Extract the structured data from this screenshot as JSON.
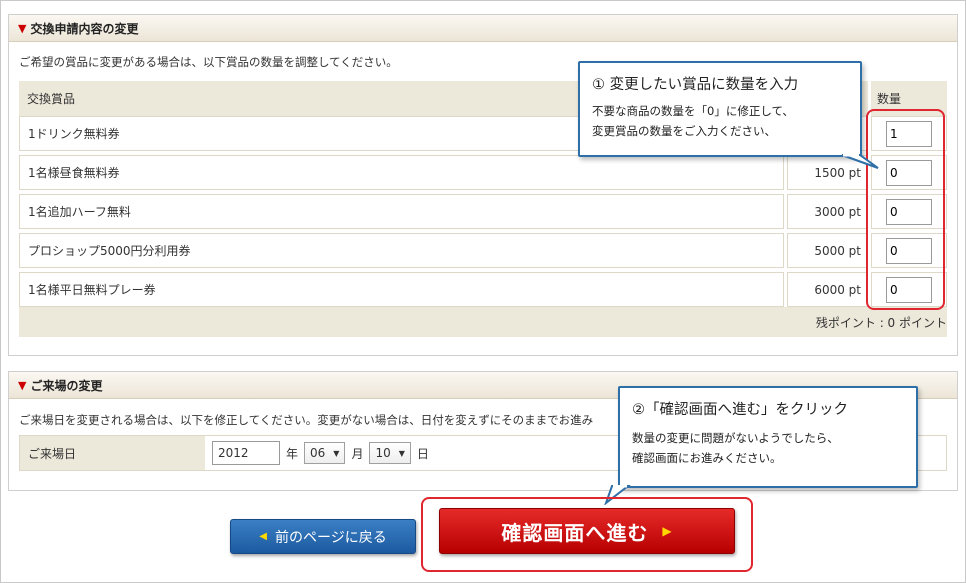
{
  "exchange_section": {
    "title": "交換申請内容の変更",
    "description": "ご希望の賞品に変更がある場合は、以下賞品の数量を調整してください。",
    "headers": {
      "item": "交換賞品",
      "qty": "数量"
    },
    "items": [
      {
        "name": "1ドリンク無料券",
        "points": "",
        "qty": "1"
      },
      {
        "name": "1名様昼食無料券",
        "points": "1500 pt",
        "qty": "0"
      },
      {
        "name": "1名追加ハーフ無料",
        "points": "3000 pt",
        "qty": "0"
      },
      {
        "name": "プロショップ5000円分利用券",
        "points": "5000 pt",
        "qty": "0"
      },
      {
        "name": "1名様平日無料プレー券",
        "points": "6000 pt",
        "qty": "0"
      }
    ],
    "remaining": "残ポイント : 0 ポイント"
  },
  "callout1": {
    "title": "① 変更したい賞品に数量を入力",
    "line1": "不要な商品の数量を「0」に修正して、",
    "line2": "変更賞品の数量をご入力ください、"
  },
  "visit_section": {
    "title": "ご来場の変更",
    "description": "ご来場日を変更される場合は、以下を修正してください。変更がない場合は、日付を変えずにそのままでお進み",
    "label": "ご来場日",
    "year": "2012",
    "year_unit": "年",
    "month": "06",
    "month_unit": "月",
    "day": "10",
    "day_unit": "日"
  },
  "callout2": {
    "title": "②「確認画面へ進む」をクリック",
    "line1": "数量の変更に問題がないようでしたら、",
    "line2": "確認画面にお進みください。"
  },
  "buttons": {
    "back": "前のページに戻る",
    "confirm": "確認画面へ進む"
  },
  "colors": {
    "accent_red": "#e0262f",
    "callout_blue": "#2f6fa8",
    "header_beige": "#ece8da"
  }
}
